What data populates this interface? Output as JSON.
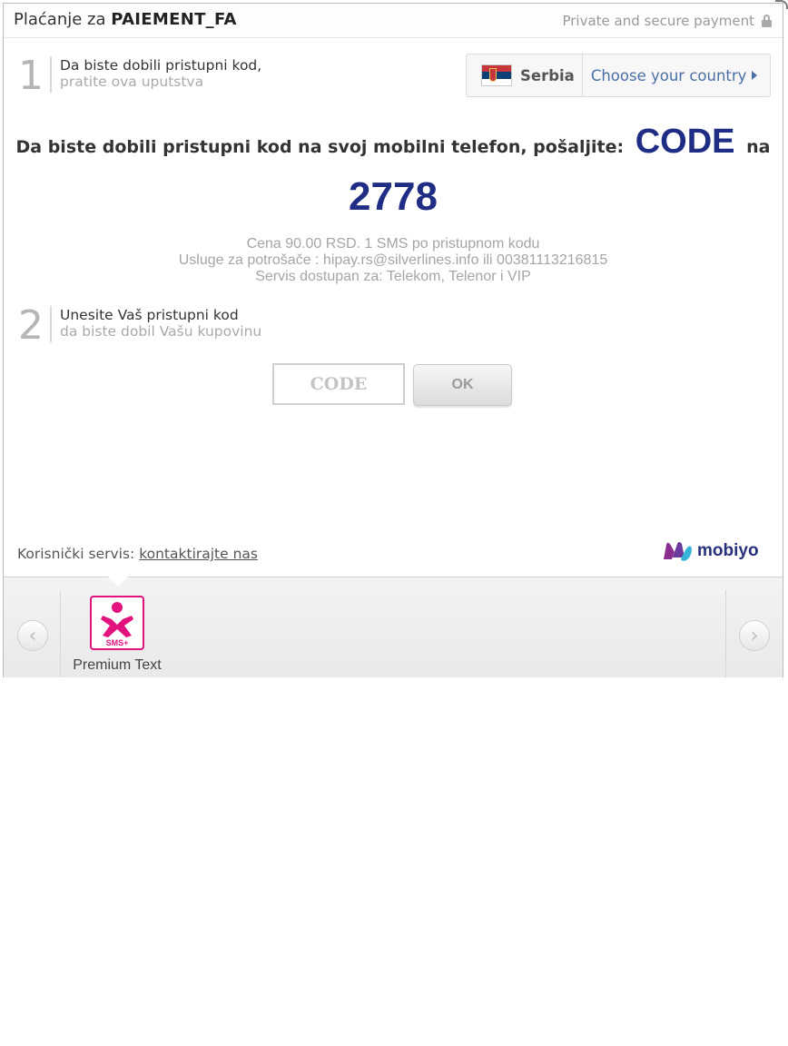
{
  "header": {
    "title_prefix": "Plaćanje za",
    "title_product": "PAIEMENT_FA",
    "secure_text": "Private and secure payment"
  },
  "step1": {
    "number": "1",
    "line1": "Da biste dobili pristupni kod,",
    "line2": "pratite ova uputstva"
  },
  "country": {
    "name": "Serbia",
    "choose_label": "Choose your country"
  },
  "instructions": {
    "text_before": "Da biste dobili pristupni kod na svoj mobilni telefon, pošaljite:",
    "keyword": "CODE",
    "text_after": "na",
    "short_number": "2778",
    "info_lines": [
      "Cena 90.00 RSD. 1 SMS po pristupnom kodu",
      "Usluge za potrošače : hipay.rs@silverlines.info ili 00381113216815",
      "Servis dostupan za: Telekom, Telenor i VIP"
    ]
  },
  "step2": {
    "number": "2",
    "line1": "Unesite Vaš pristupni kod",
    "line2": "da biste dobil Vašu kupovinu"
  },
  "form": {
    "code_placeholder": "CODE",
    "code_value": "",
    "ok_label": "OK"
  },
  "footer": {
    "support_label": "Korisnički servis:",
    "support_link": "kontaktirajte nas",
    "brand": "mobiyo"
  },
  "payment_methods": [
    {
      "label": "Premium Text",
      "icon": "sms-plus-icon",
      "icon_text": "SMS+",
      "color": "#e2137f"
    }
  ],
  "colors": {
    "accent_blue": "#1f2d85",
    "link_blue": "#4a6fa5",
    "sms_pink": "#e2137f"
  }
}
